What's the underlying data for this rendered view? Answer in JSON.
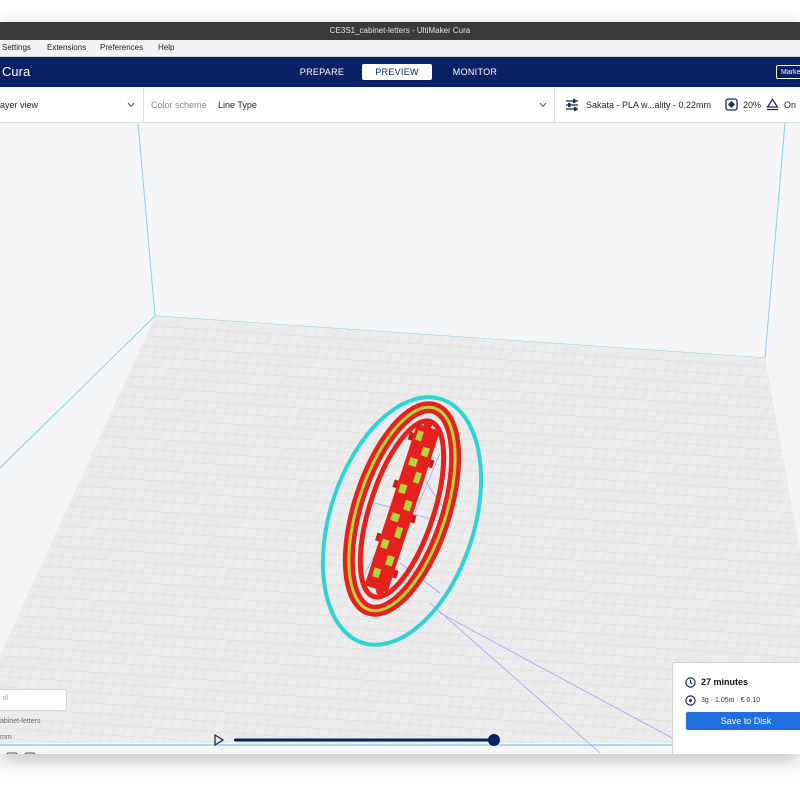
{
  "window": {
    "title": "CE3S1_cabinet-letters - UltiMaker Cura"
  },
  "menu": {
    "items": [
      "Settings",
      "Extensions",
      "Preferences",
      "Help"
    ]
  },
  "header": {
    "brand": "Cura",
    "tabs": [
      {
        "label": "PREPARE",
        "active": false
      },
      {
        "label": "PREVIEW",
        "active": true
      },
      {
        "label": "MONITOR",
        "active": false
      }
    ],
    "marketplace_label": "Marke"
  },
  "toolbar": {
    "view_mode": "ayer view",
    "color_scheme_label": "Color scheme",
    "color_scheme_value": "Line Type",
    "profile": "Sakata - PLA w...ality - 0.22mm",
    "infill": "20%",
    "support": "On"
  },
  "object_panel": {
    "search_value": "ıll",
    "object_name": "abinet-letters",
    "dims_unit": "mm"
  },
  "print_summary": {
    "time": "27 minutes",
    "material": "3g · 1.05m · € 0.10",
    "save_label": "Save to Disk"
  },
  "colors": {
    "header_bg": "#0b2166",
    "accent": "#1f6fe0",
    "skirt": "#2fd3d3",
    "wall_outer": "#e6201c",
    "wall_inner": "#a7d13c",
    "travel": "#8a8cf0"
  },
  "icons": {
    "settings": "sliders-icon",
    "infill": "infill-icon",
    "support": "support-icon",
    "clock": "clock-icon",
    "material": "spool-icon",
    "play": "play-icon"
  }
}
